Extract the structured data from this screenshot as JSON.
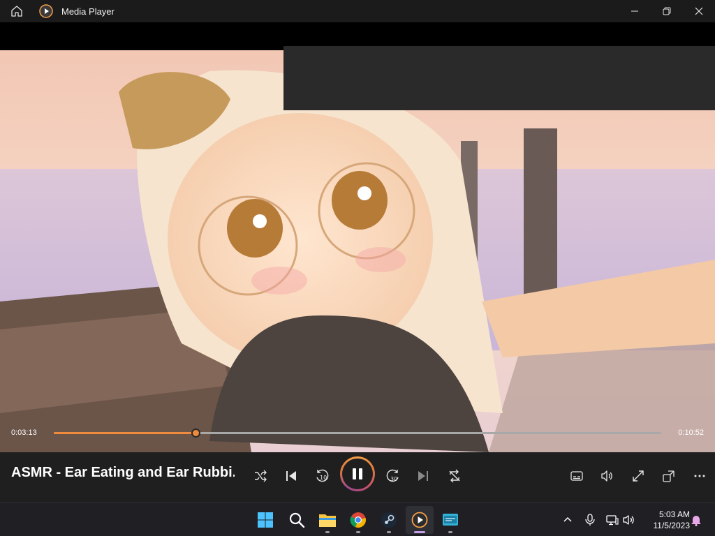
{
  "window": {
    "title": "Media Player",
    "icons": {
      "home": "home-icon",
      "app": "media-player-icon",
      "minimize": "minimize-icon",
      "restore": "restore-icon",
      "close": "close-icon"
    }
  },
  "player": {
    "media_title": "ASMR - Ear Eating and Ear Rubbi...",
    "current_time": "0:03:13",
    "total_time": "0:10:52",
    "progress": 0.2331,
    "accent": "#f08a3c",
    "controls_left": [
      "shuffle-icon",
      "previous-icon",
      "rewind-10-icon",
      "pause-icon",
      "forward-30-icon",
      "next-icon",
      "repeat-off-icon"
    ],
    "controls_right": [
      "subtitles-icon",
      "volume-icon",
      "fullscreen-icon",
      "mini-player-icon",
      "more-icon"
    ]
  },
  "taskbar": {
    "apps": [
      "windows-start-icon",
      "search-icon",
      "file-explorer-icon",
      "chrome-icon",
      "steam-icon",
      "media-player-icon",
      "remote-desktop-icon"
    ],
    "tray": [
      "chevron-up-icon",
      "microphone-icon",
      "network-icon",
      "speaker-icon",
      "notification-bell-icon"
    ],
    "time": "5:03 AM",
    "date": "11/5/2023"
  }
}
